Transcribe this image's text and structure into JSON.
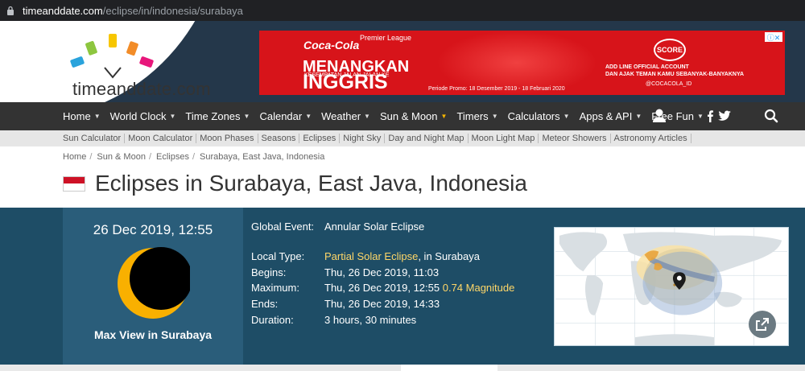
{
  "browser": {
    "url_host": "timeanddate.com",
    "url_path": "/eclipse/in/indonesia/surabaya",
    "lock_icon": "lock-icon"
  },
  "header": {
    "logo_text": "timeanddate.com",
    "ad": {
      "brand": "Coca-Cola",
      "league": "Premier League",
      "headline1": "MENANGKAN",
      "headline1_sub": "KESEMPATAN JALAN-JALAN KE",
      "headline2": "INGGRIS",
      "promo": "Periode Promo: 18 Desember 2019 - 18 Februari 2020",
      "score": "SCORE",
      "line_text1": "ADD LINE OFFICIAL ACCOUNT",
      "line_text2": "DAN AJAK TEMAN KAMU SEBANYAK-BANYAKNYA",
      "line_text3": "@COCACOLA_ID"
    }
  },
  "nav": {
    "items": [
      {
        "label": "Home"
      },
      {
        "label": "World Clock"
      },
      {
        "label": "Time Zones"
      },
      {
        "label": "Calendar"
      },
      {
        "label": "Weather"
      },
      {
        "label": "Sun & Moon"
      },
      {
        "label": "Timers"
      },
      {
        "label": "Calculators"
      },
      {
        "label": "Apps & API"
      },
      {
        "label": "Free Fun"
      }
    ],
    "icons": [
      "user-icon",
      "facebook-icon",
      "twitter-icon",
      "search-icon"
    ]
  },
  "subnav": {
    "items": [
      "Sun Calculator",
      "Moon Calculator",
      "Moon Phases",
      "Seasons",
      "Eclipses",
      "Night Sky",
      "Day and Night Map",
      "Moon Light Map",
      "Meteor Showers",
      "Astronomy Articles"
    ]
  },
  "breadcrumb": [
    "Home",
    "Sun & Moon",
    "Eclipses",
    "Surabaya, East Java, Indonesia"
  ],
  "page_title": "Eclipses in Surabaya, East Java, Indonesia",
  "eclipse": {
    "date_time": "26 Dec 2019, 12:55",
    "card_label": "Max View in Surabaya",
    "global_event_label": "Global Event:",
    "global_event": "Annular Solar Eclipse",
    "local_type_label": "Local Type:",
    "local_type": "Partial Solar Eclipse",
    "local_type_suffix": ", in Surabaya",
    "begins_label": "Begins:",
    "begins": "Thu, 26 Dec 2019, 11:03",
    "maximum_label": "Maximum:",
    "maximum": "Thu, 26 Dec 2019, 12:55",
    "magnitude": "0.74 Magnitude",
    "ends_label": "Ends:",
    "ends": "Thu, 26 Dec 2019, 14:33",
    "duration_label": "Duration:",
    "duration": "3 hours, 30 minutes"
  },
  "colors": {
    "panel": "#1e4d66",
    "card": "#2a5d7a",
    "highlight": "#ffd768",
    "nav": "#333333"
  }
}
